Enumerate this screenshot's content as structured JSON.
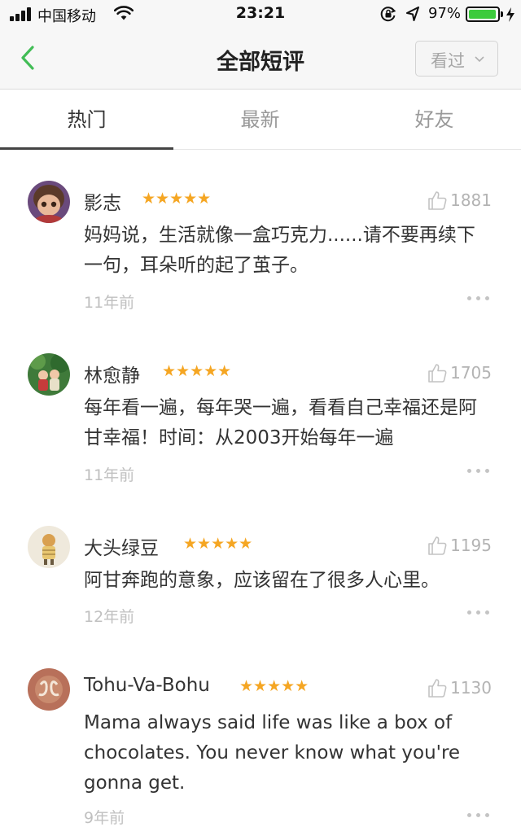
{
  "status_bar": {
    "carrier": "中国移动",
    "time": "23:21",
    "battery": "97%",
    "battery_level": 0.97
  },
  "nav": {
    "title": "全部短评",
    "filter_label": "看过"
  },
  "tabs": [
    {
      "label": "热门",
      "active": true
    },
    {
      "label": "最新",
      "active": false
    },
    {
      "label": "好友",
      "active": false
    }
  ],
  "comments": [
    {
      "author": "影志",
      "stars": "★★★★★",
      "rating": 5,
      "votes": "1881",
      "text": "妈妈说，生活就像一盒巧克力......请不要再续下一句，耳朵听的起了茧子。",
      "time": "11年前"
    },
    {
      "author": "林愈静",
      "stars": "★★★★★",
      "rating": 5,
      "votes": "1705",
      "text": "每年看一遍，每年哭一遍，看看自己幸福还是阿甘幸福！时间：从2003开始每年一遍",
      "time": "11年前"
    },
    {
      "author": "大头绿豆",
      "stars": "★★★★★",
      "rating": 5,
      "votes": "1195",
      "text": "阿甘奔跑的意象，应该留在了很多人心里。",
      "time": "12年前"
    },
    {
      "author": "Tohu-Va-Bohu",
      "stars": "★★★★★",
      "rating": 5,
      "votes": "1130",
      "text": "Mama always said life was like a box of chocolates. You never know what you're gonna get.",
      "time": "9年前"
    }
  ],
  "colors": {
    "accent_green": "#42bd56",
    "star": "#f5a623",
    "battery_green": "#3ccb3c"
  },
  "icons": [
    "signal-icon",
    "wifi-icon",
    "lock-rotation-icon",
    "location-icon",
    "battery-icon",
    "charging-bolt-icon",
    "back-chevron-icon",
    "chevron-down-icon",
    "thumbs-up-icon",
    "more-icon"
  ]
}
